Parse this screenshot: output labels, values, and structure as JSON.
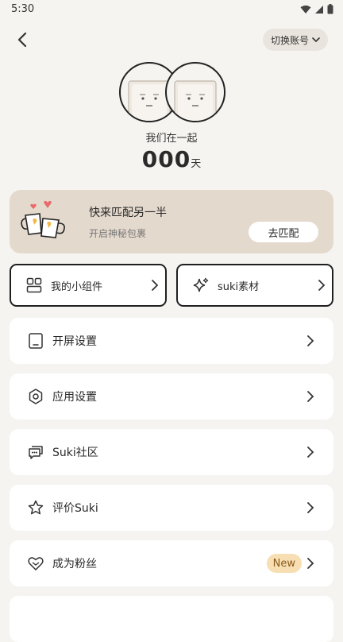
{
  "status_bar": {
    "time": "5:30"
  },
  "header": {
    "switch_account_label": "切换账号"
  },
  "couple": {
    "together_label": "我们在一起",
    "days_count": "000",
    "days_unit": "天"
  },
  "match_card": {
    "title": "快来匹配另一半",
    "subtitle": "开启神秘包裹",
    "button_label": "去匹配"
  },
  "tiles": [
    {
      "label": "我的小组件",
      "icon": "widgets-icon"
    },
    {
      "label": "suki素材",
      "icon": "sparkle-icon"
    }
  ],
  "settings": [
    {
      "label": "开屏设置",
      "icon": "phone-screen-icon"
    },
    {
      "label": "应用设置",
      "icon": "gear-icon"
    },
    {
      "label": "Suki社区",
      "icon": "chat-bubbles-icon"
    },
    {
      "label": "评价Suki",
      "icon": "star-icon"
    },
    {
      "label": "成为粉丝",
      "icon": "heart-icon",
      "badge": "New"
    }
  ],
  "colors": {
    "background": "#f6f4f1",
    "match_card": "#e4d9cd",
    "new_badge_bg": "#f7dfb3",
    "new_badge_text": "#8a5a18"
  }
}
